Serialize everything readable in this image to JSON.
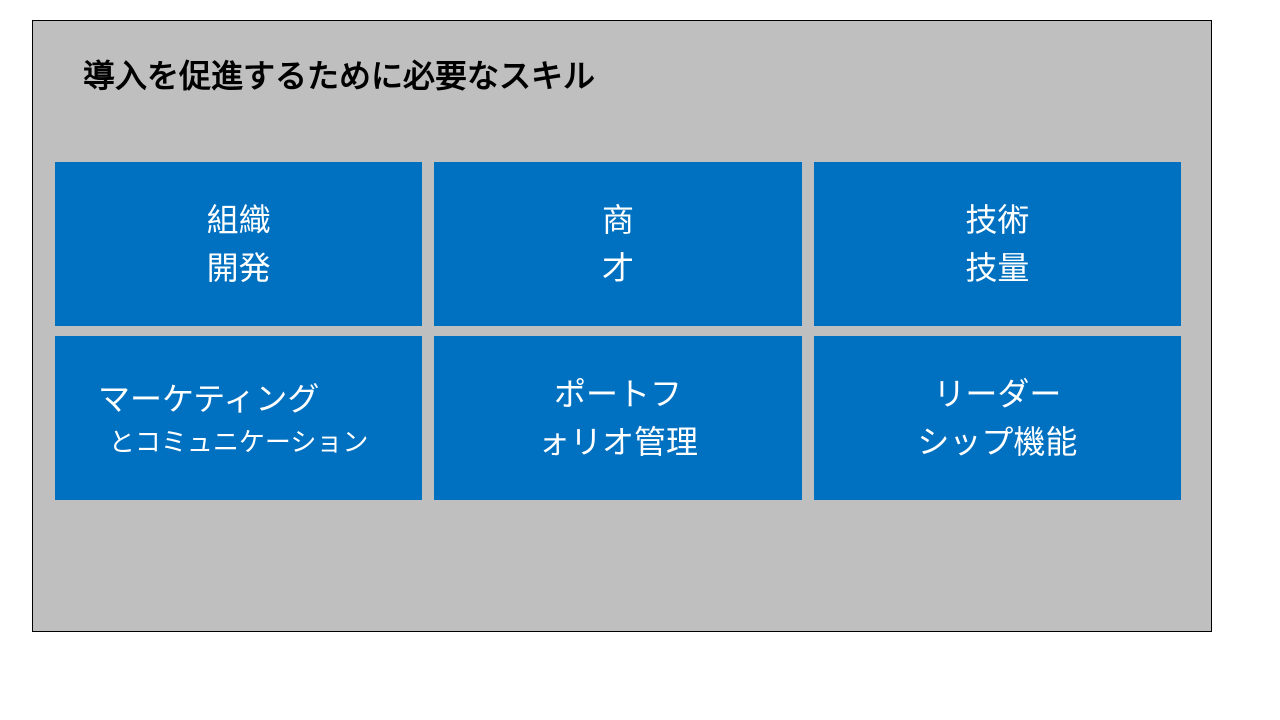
{
  "title": "導入を促進するために必要なスキル",
  "tiles": [
    {
      "line1": "組織",
      "line2": "開発"
    },
    {
      "line1": "商",
      "line2": "才"
    },
    {
      "line1": "技術",
      "line2": "技量"
    },
    {
      "line1": "マーケティング",
      "line2": "とコミュニケーション"
    },
    {
      "line1": "ポートフ",
      "line2": "ォリオ管理"
    },
    {
      "line1": "リーダー",
      "line2": "シップ機能"
    }
  ]
}
